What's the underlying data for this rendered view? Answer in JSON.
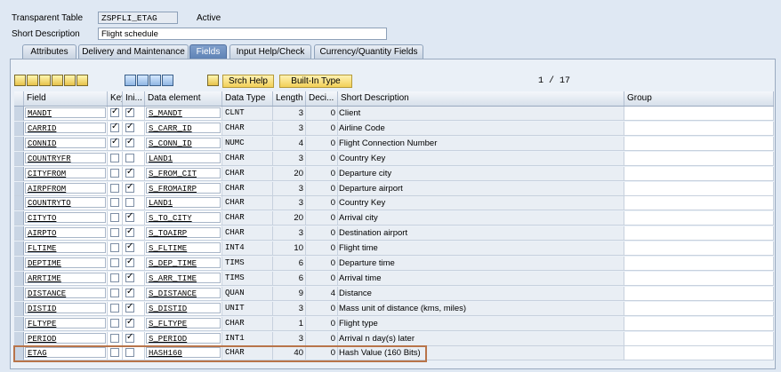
{
  "header": {
    "table_label": "Transparent Table",
    "table_name": "ZSPFLI_ETAG",
    "status": "Active",
    "short_desc_label": "Short Description",
    "short_desc_value": "Flight schedule"
  },
  "tabs": [
    {
      "label": "Attributes"
    },
    {
      "label": "Delivery and Maintenance"
    },
    {
      "label": "Fields"
    },
    {
      "label": "Input Help/Check"
    },
    {
      "label": "Currency/Quantity Fields"
    }
  ],
  "active_tab": "Fields",
  "toolbar": {
    "srch_help_label": "Srch Help",
    "builtin_type_label": "Built-In Type",
    "pager": "1 / 17"
  },
  "columns": [
    "Field",
    "Key",
    "Ini...",
    "Data element",
    "Data Type",
    "Length",
    "Deci...",
    "Short Description",
    "Group"
  ],
  "rows": [
    {
      "field": "MANDT",
      "key": true,
      "init": true,
      "elem": "S_MANDT",
      "type": "CLNT",
      "len": "3",
      "dec": "0",
      "desc": "Client"
    },
    {
      "field": "CARRID",
      "key": true,
      "init": true,
      "elem": "S_CARR_ID",
      "type": "CHAR",
      "len": "3",
      "dec": "0",
      "desc": "Airline Code"
    },
    {
      "field": "CONNID",
      "key": true,
      "init": true,
      "elem": "S_CONN_ID",
      "type": "NUMC",
      "len": "4",
      "dec": "0",
      "desc": "Flight Connection Number"
    },
    {
      "field": "COUNTRYFR",
      "key": false,
      "init": false,
      "elem": "LAND1",
      "type": "CHAR",
      "len": "3",
      "dec": "0",
      "desc": "Country Key"
    },
    {
      "field": "CITYFROM",
      "key": false,
      "init": true,
      "elem": "S_FROM_CIT",
      "type": "CHAR",
      "len": "20",
      "dec": "0",
      "desc": "Departure city"
    },
    {
      "field": "AIRPFROM",
      "key": false,
      "init": true,
      "elem": "S_FROMAIRP",
      "type": "CHAR",
      "len": "3",
      "dec": "0",
      "desc": "Departure airport"
    },
    {
      "field": "COUNTRYTO",
      "key": false,
      "init": false,
      "elem": "LAND1",
      "type": "CHAR",
      "len": "3",
      "dec": "0",
      "desc": "Country Key"
    },
    {
      "field": "CITYTO",
      "key": false,
      "init": true,
      "elem": "S_TO_CITY",
      "type": "CHAR",
      "len": "20",
      "dec": "0",
      "desc": "Arrival city"
    },
    {
      "field": "AIRPTO",
      "key": false,
      "init": true,
      "elem": "S_TOAIRP",
      "type": "CHAR",
      "len": "3",
      "dec": "0",
      "desc": "Destination airport"
    },
    {
      "field": "FLTIME",
      "key": false,
      "init": true,
      "elem": "S_FLTIME",
      "type": "INT4",
      "len": "10",
      "dec": "0",
      "desc": "Flight time"
    },
    {
      "field": "DEPTIME",
      "key": false,
      "init": true,
      "elem": "S_DEP_TIME",
      "type": "TIMS",
      "len": "6",
      "dec": "0",
      "desc": "Departure time"
    },
    {
      "field": "ARRTIME",
      "key": false,
      "init": true,
      "elem": "S_ARR_TIME",
      "type": "TIMS",
      "len": "6",
      "dec": "0",
      "desc": "Arrival time"
    },
    {
      "field": "DISTANCE",
      "key": false,
      "init": true,
      "elem": "S_DISTANCE",
      "type": "QUAN",
      "len": "9",
      "dec": "4",
      "desc": "Distance"
    },
    {
      "field": "DISTID",
      "key": false,
      "init": true,
      "elem": "S_DISTID",
      "type": "UNIT",
      "len": "3",
      "dec": "0",
      "desc": "Mass unit of distance (kms, miles)"
    },
    {
      "field": "FLTYPE",
      "key": false,
      "init": true,
      "elem": "S_FLTYPE",
      "type": "CHAR",
      "len": "1",
      "dec": "0",
      "desc": "Flight type"
    },
    {
      "field": "PERIOD",
      "key": false,
      "init": true,
      "elem": "S_PERIOD",
      "type": "INT1",
      "len": "3",
      "dec": "0",
      "desc": "Arrival n day(s) later"
    },
    {
      "field": "ETAG",
      "key": false,
      "init": false,
      "elem": "HASH160",
      "type": "CHAR",
      "len": "40",
      "dec": "0",
      "desc": "Hash Value (160 Bits)"
    }
  ],
  "colors": {
    "highlight": "#b8744a",
    "active_tab": "#5f83b6"
  }
}
